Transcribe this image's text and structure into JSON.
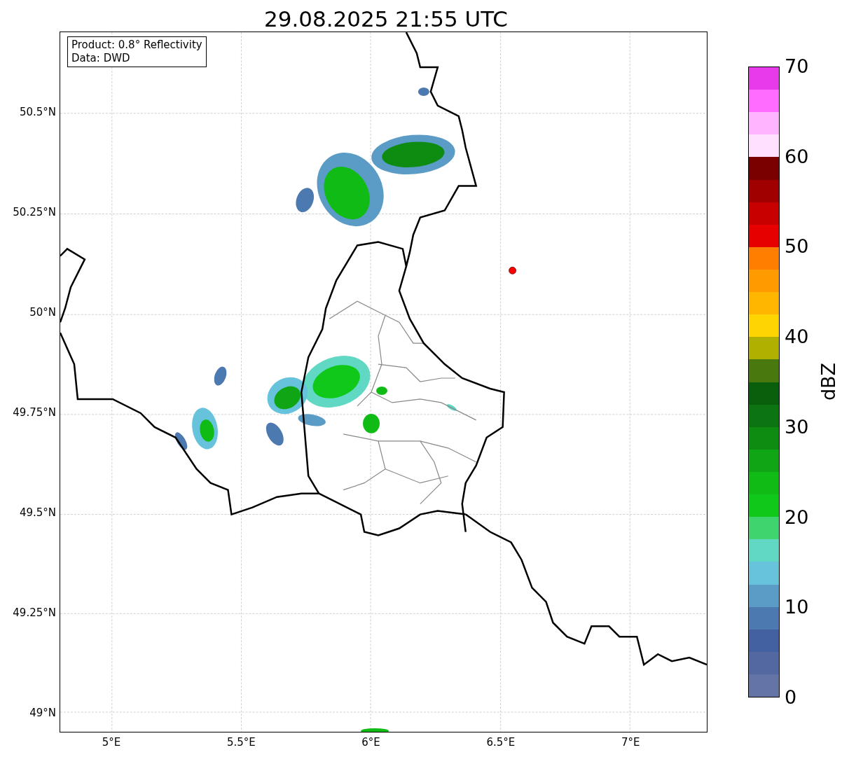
{
  "title": "29.08.2025 21:55 UTC",
  "info_box": [
    "Product: 0.8° Reflectivity",
    "Data: DWD"
  ],
  "lat_ticks": [
    "50.5°N",
    "50.25°N",
    "50°N",
    "49.75°N",
    "49.5°N",
    "49.25°N",
    "49°N"
  ],
  "lon_ticks": [
    "5°E",
    "5.5°E",
    "6°E",
    "6.5°E",
    "7°E"
  ],
  "colorbar": {
    "label": "dBZ",
    "ticks": [
      "70",
      "60",
      "50",
      "40",
      "30",
      "20",
      "10",
      "0"
    ],
    "bins": [
      {
        "color": "#6474a6"
      },
      {
        "color": "#5367a0"
      },
      {
        "color": "#4360a1"
      },
      {
        "color": "#4b79b0"
      },
      {
        "color": "#5b9cc6"
      },
      {
        "color": "#67c3dc"
      },
      {
        "color": "#60d8c3"
      },
      {
        "color": "#3fd46e"
      },
      {
        "color": "#10c81a"
      },
      {
        "color": "#10bb16"
      },
      {
        "color": "#0fa514"
      },
      {
        "color": "#0e8c12"
      },
      {
        "color": "#0c7410"
      },
      {
        "color": "#095f0b"
      },
      {
        "color": "#48780e"
      },
      {
        "color": "#b0b000"
      },
      {
        "color": "#fed500"
      },
      {
        "color": "#feb600"
      },
      {
        "color": "#ff9b00"
      },
      {
        "color": "#ff7e00"
      },
      {
        "color": "#e60000"
      },
      {
        "color": "#c80000"
      },
      {
        "color": "#a00000"
      },
      {
        "color": "#7a0000"
      },
      {
        "color": "#ffe0ff"
      },
      {
        "color": "#ffb4ff"
      },
      {
        "color": "#ff6cff"
      },
      {
        "color": "#e83ae8"
      }
    ]
  }
}
